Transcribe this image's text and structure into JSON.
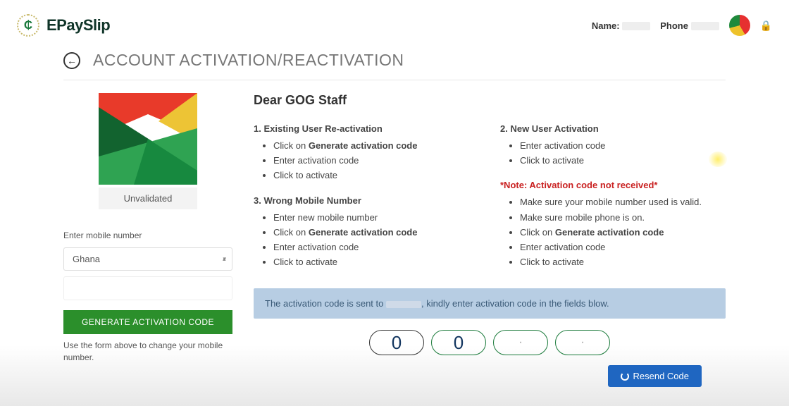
{
  "brand": {
    "name": "EPaySlip"
  },
  "header": {
    "name_label": "Name:",
    "phone_label": "Phone"
  },
  "page_title": "ACCOUNT ACTIVATION/REACTIVATION",
  "left": {
    "status": "Unvalidated",
    "enter_mobile_label": "Enter mobile number",
    "country_selected": "Ghana",
    "generate_button": "GENERATE ACTIVATION CODE",
    "helper_text": "Use the form above to change your mobile number."
  },
  "content": {
    "greeting": "Dear GOG Staff",
    "section1": {
      "title": "1. Existing User Re-activation",
      "items_pre": [
        "Click on "
      ],
      "gen_bold": "Generate activation code",
      "items_post": [
        "Enter activation code",
        "Click to activate"
      ]
    },
    "section3": {
      "title": "3. Wrong Mobile Number",
      "pre": "Enter new mobile number",
      "click_on": "Click on ",
      "gen_bold": "Generate activation code",
      "post": [
        "Enter activation code",
        "Click to activate"
      ]
    },
    "section2": {
      "title": "2. New User Activation",
      "items": [
        "Enter activation code",
        "Click to activate"
      ]
    },
    "note": {
      "title": "*Note: Activation code not received*",
      "items_pre": [
        "Make sure your mobile number used is valid.",
        "Make sure mobile phone is on."
      ],
      "click_on": "Click on ",
      "gen_bold": "Generate activation code",
      "items_post": [
        "Enter activation code",
        "Click to activate"
      ]
    },
    "banner_pre": "The activation code is sent to ",
    "banner_post": ", kindly enter activation code in the fields blow.",
    "code_values": [
      "0",
      "0",
      "·",
      "·"
    ],
    "resend_label": "Resend Code"
  }
}
